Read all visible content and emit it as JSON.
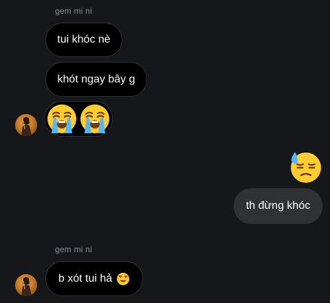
{
  "conversation": {
    "group1": {
      "sender": "gem mi ni",
      "messages": [
        "tui khóc nè",
        "khót ngay bây g"
      ],
      "emojis": [
        "loudly-crying-face",
        "loudly-crying-face"
      ]
    },
    "outgoing": {
      "emoji": "downcast-face-with-sweat",
      "message": "th đừng khóc"
    },
    "group2": {
      "sender": "gem mi ni",
      "message": "b xót tui hả",
      "inline_emoji": "smiling-face-with-heart-eyes"
    }
  },
  "colors": {
    "background": "#15171b",
    "incoming_bubble": "#000000",
    "incoming_border": "#2e3238",
    "outgoing_bubble": "#2f3135",
    "sender_name": "#8d9198",
    "text": "#ffffff"
  }
}
